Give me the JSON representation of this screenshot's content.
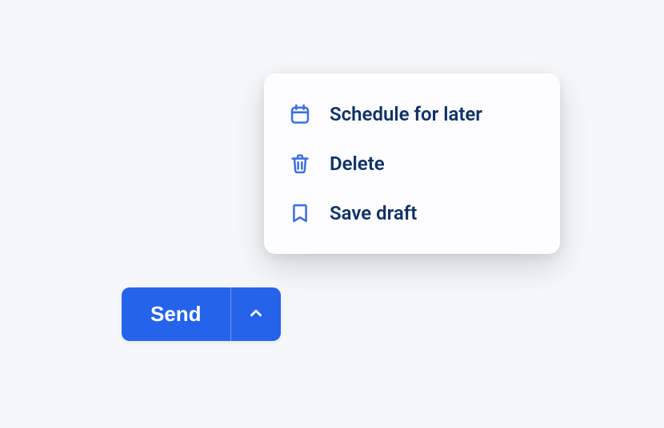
{
  "button": {
    "primary_label": "Send"
  },
  "menu": {
    "items": [
      {
        "label": "Schedule for later",
        "icon": "calendar-icon"
      },
      {
        "label": "Delete",
        "icon": "trash-icon"
      },
      {
        "label": "Save draft",
        "icon": "bookmark-icon"
      }
    ]
  },
  "colors": {
    "primary": "#2563eb",
    "menu_text": "#0f3266",
    "menu_icon": "#3f72de"
  }
}
